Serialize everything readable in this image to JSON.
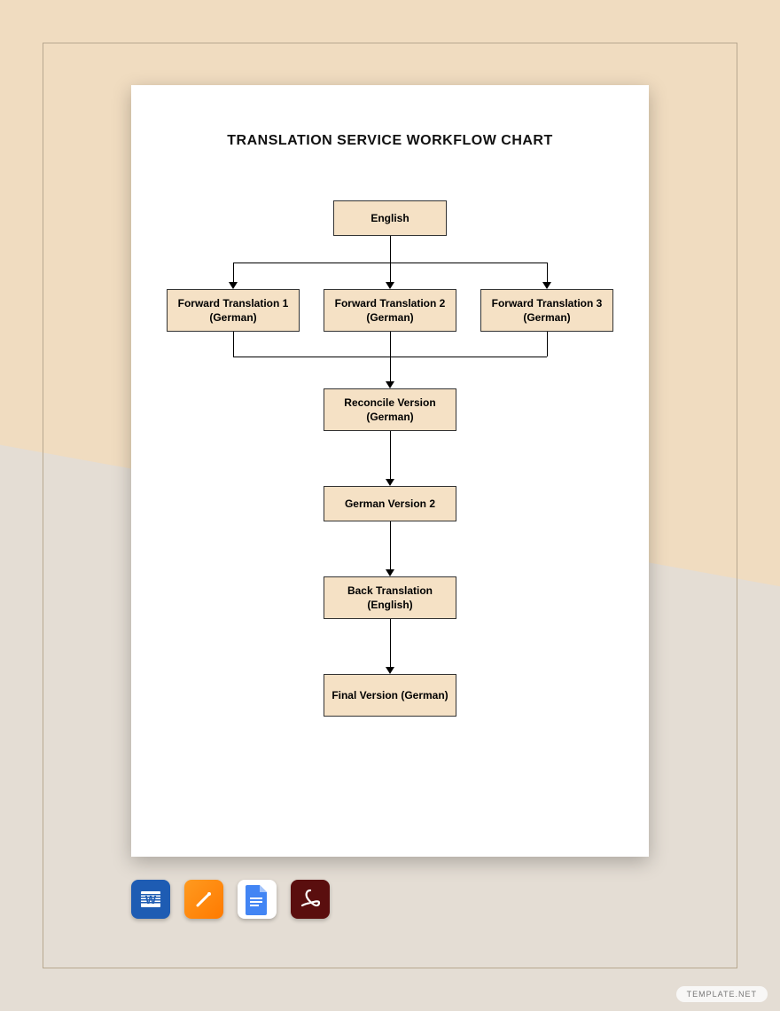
{
  "title": "TRANSLATION SERVICE WORKFLOW CHART",
  "nodes": {
    "english": "English",
    "ft1": "Forward Translation 1 (German)",
    "ft2": "Forward Translation 2 (German)",
    "ft3": "Forward Translation 3 (German)",
    "reconcile": "Reconcile Version (German)",
    "german2": "German Version 2",
    "backtrans": "Back Translation (English)",
    "final": "Final Version (German)"
  },
  "icons": {
    "word": "word-icon",
    "pages": "pages-icon",
    "gdocs": "google-docs-icon",
    "pdf": "pdf-icon"
  },
  "watermark": "TEMPLATE.NET"
}
